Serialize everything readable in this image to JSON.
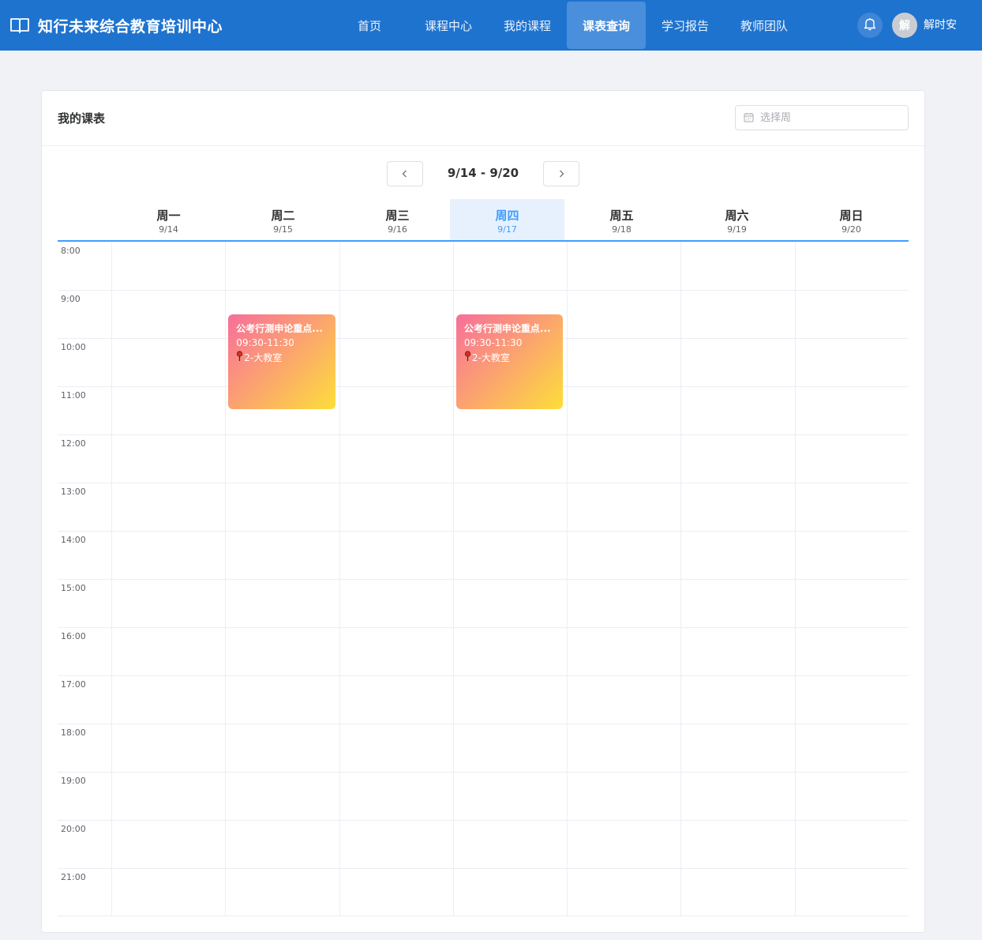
{
  "brand": {
    "title": "知行未来综合教育培训中心"
  },
  "nav": {
    "items": [
      {
        "label": "首页"
      },
      {
        "label": "课程中心"
      },
      {
        "label": "我的课程"
      },
      {
        "label": "课表查询"
      },
      {
        "label": "学习报告"
      },
      {
        "label": "教师团队"
      }
    ],
    "active_index": 3
  },
  "user": {
    "avatar_text": "解",
    "name": "解时安"
  },
  "schedule": {
    "title": "我的课表",
    "week_picker_placeholder": "选择周",
    "range": "9/14 - 9/20",
    "days": [
      {
        "name": "周一",
        "date": "9/14",
        "today": false
      },
      {
        "name": "周二",
        "date": "9/15",
        "today": false
      },
      {
        "name": "周三",
        "date": "9/16",
        "today": false
      },
      {
        "name": "周四",
        "date": "9/17",
        "today": true
      },
      {
        "name": "周五",
        "date": "9/18",
        "today": false
      },
      {
        "name": "周六",
        "date": "9/19",
        "today": false
      },
      {
        "name": "周日",
        "date": "9/20",
        "today": false
      }
    ],
    "hours": [
      "8:00",
      "9:00",
      "10:00",
      "11:00",
      "12:00",
      "13:00",
      "14:00",
      "15:00",
      "16:00",
      "17:00",
      "18:00",
      "19:00",
      "20:00",
      "21:00"
    ],
    "events": [
      {
        "day_index": 1,
        "title": "公考行测申论重点...",
        "time": "09:30-11:30",
        "room": "2-大教室",
        "start_hour": 9.5,
        "end_hour": 11.5
      },
      {
        "day_index": 3,
        "title": "公考行测申论重点...",
        "time": "09:30-11:30",
        "room": "2-大教室",
        "start_hour": 9.5,
        "end_hour": 11.5
      }
    ]
  },
  "colors": {
    "header_bg": "#1e73cf",
    "accent": "#409eff",
    "event_gradient": [
      "#f76e9a",
      "#fb9f73",
      "#fdde3a"
    ]
  }
}
